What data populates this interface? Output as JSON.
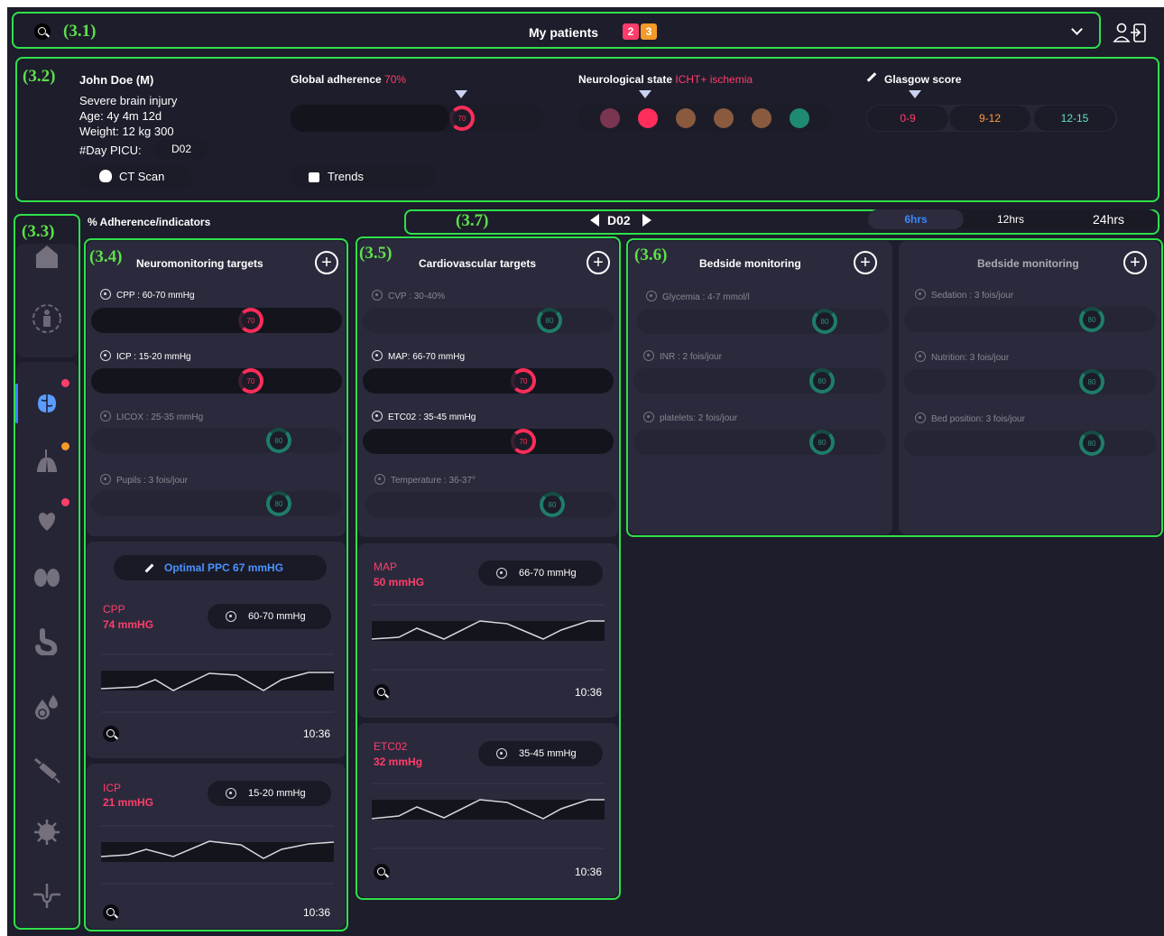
{
  "topbar": {
    "title": "My patients",
    "badge_red": "2",
    "badge_orange": "3",
    "annot": "(3.1)"
  },
  "patient": {
    "annot": "(3.2)",
    "name": "John Doe (M)",
    "diagnosis": "Severe brain injury",
    "age": "Age: 4y 4m 12d",
    "weight": "Weight: 12 kg 300",
    "day_label": "#Day PICU:",
    "day_value": "D02",
    "ct_button": "CT Scan",
    "trends_button": "Trends"
  },
  "adherence": {
    "label": "Global adherence",
    "value": "70%",
    "ring": "70",
    "fraction": 0.7
  },
  "neuro": {
    "label": "Neurological state",
    "value": "ICHT+ ischemia",
    "dot_colors": [
      "#7a3550",
      "#ff2d5a",
      "#8a5a3e",
      "#8a5a3e",
      "#8a5a3e",
      "#1e8a72"
    ]
  },
  "glasgow": {
    "label": "Glasgow score",
    "ranges": [
      "0-9",
      "9-12",
      "12-15"
    ],
    "colors": [
      "#ff3d6b",
      "#ff9a3c",
      "#5ee0c0"
    ]
  },
  "nav": {
    "annot": "(3.3)"
  },
  "toolbar": {
    "title": "% Adherence/indicators",
    "annot": "(3.7)",
    "day": "D02",
    "tabs": [
      "6hrs",
      "12hrs",
      "24hrs"
    ]
  },
  "neuro_panel": {
    "annot": "(3.4)",
    "title": "Neuromonitoring targets",
    "items": [
      {
        "label": "CPP : 60-70 mmHg",
        "ring": "70"
      },
      {
        "label": "ICP : 15-20 mmHg",
        "ring": "70"
      },
      {
        "label": "LICOX : 25-35 mmHg",
        "ring": "80"
      },
      {
        "label": "Pupils : 3 fois/jour",
        "ring": "80"
      }
    ],
    "optimal": "Optimal PPC  67 mmHG",
    "charts": [
      {
        "name": "CPP",
        "value": "74 mmHG",
        "target": "60-70 mmHg",
        "time": "10:36"
      },
      {
        "name": "ICP",
        "value": "21 mmHG",
        "target": "15-20 mmHg",
        "time": "10:36"
      }
    ]
  },
  "cardio_panel": {
    "annot": "(3.5)",
    "title": "Cardiovascular targets",
    "items": [
      {
        "label": "CVP :  30-40%",
        "ring": "80"
      },
      {
        "label": "MAP: 66-70 mmHg",
        "ring": "70"
      },
      {
        "label": "ETC02 : 35-45 mmHg",
        "ring": "70"
      },
      {
        "label": "Temperature : 36-37°",
        "ring": "80"
      }
    ],
    "charts": [
      {
        "name": "MAP",
        "value": "50 mmHG",
        "target": "66-70 mmHg",
        "time": "10:36"
      },
      {
        "name": "ETC02",
        "value": "32 mmHg",
        "target": "35-45 mmHg",
        "time": "10:36"
      }
    ]
  },
  "bedside1": {
    "annot": "(3.6)",
    "title": "Bedside monitoring",
    "items": [
      {
        "label": "Glycemia : 4-7 mmol/l",
        "ring": "80"
      },
      {
        "label": "INR : 2 fois/jour",
        "ring": "80"
      },
      {
        "label": "platelets: 2 fois/jour",
        "ring": "80"
      }
    ]
  },
  "bedside2": {
    "title": "Bedside monitoring",
    "items": [
      {
        "label": "Sedation : 3 fois/jour",
        "ring": "80"
      },
      {
        "label": "Nutrition: 3 fois/jour",
        "ring": "80"
      },
      {
        "label": "Bed position: 3 fois/jour",
        "ring": "80"
      }
    ]
  }
}
